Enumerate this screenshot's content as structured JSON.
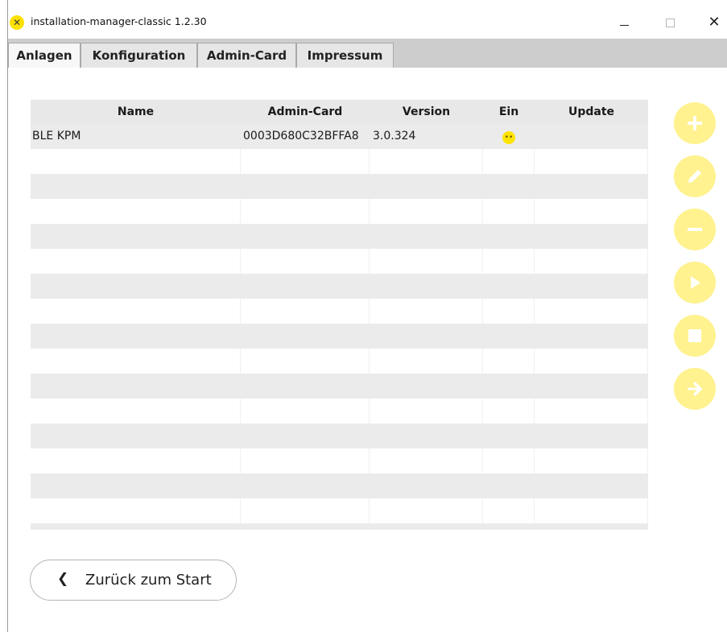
{
  "window": {
    "logo_glyph": "✕",
    "title": "installation-manager-classic 1.2.30",
    "close_glyph": "✕"
  },
  "tabs": [
    {
      "label": "Anlagen",
      "active": true
    },
    {
      "label": "Konfiguration",
      "active": false
    },
    {
      "label": "Admin-Card",
      "active": false
    },
    {
      "label": "Impressum",
      "active": false
    }
  ],
  "table": {
    "columns": [
      "Name",
      "Admin-Card",
      "Version",
      "Ein",
      "Update"
    ],
    "rows": [
      {
        "name": "BLE KPM",
        "admin_card": "0003D680C32BFFA8",
        "version": "3.0.324",
        "ein": "sad-face",
        "update": ""
      }
    ],
    "ein_icon_glyph": "••"
  },
  "actions": [
    {
      "name": "add",
      "icon": "plus-icon"
    },
    {
      "name": "edit",
      "icon": "pencil-icon"
    },
    {
      "name": "remove",
      "icon": "minus-icon"
    },
    {
      "name": "start",
      "icon": "play-icon"
    },
    {
      "name": "stop",
      "icon": "stop-icon"
    },
    {
      "name": "forward",
      "icon": "arrow-right-icon"
    }
  ],
  "back_button": {
    "chevron": "❮",
    "label": "Zurück zum Start"
  },
  "colors": {
    "accent": "#ffe100",
    "action_button": "#fff28f",
    "action_icon": "#ffffff",
    "row_alt": "#ebebeb",
    "tabbar": "#cdcdcd"
  }
}
